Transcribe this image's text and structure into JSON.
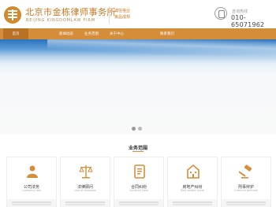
{
  "header": {
    "firm_name": "北京市金栋律师事务所",
    "firm_name_en": "BEIJING KINGDOMLAW FIRM",
    "slogan_line1": "诚信恪业",
    "slogan_line2": "良品成规",
    "hotline_label": "咨询热线",
    "hotline_number": "010-65071962"
  },
  "nav": {
    "items": [
      {
        "label": "首页",
        "active": true
      },
      {
        "label": "",
        "active": false
      },
      {
        "label": "新闻动态",
        "active": false
      },
      {
        "label": "业务范围",
        "active": false
      },
      {
        "label": "关于中心",
        "active": false
      },
      {
        "label": "",
        "active": false
      },
      {
        "label": "联系我们",
        "active": false
      }
    ]
  },
  "section": {
    "title": "业务范围"
  },
  "cards": [
    {
      "title": "公司法务",
      "subtitle": "Company law",
      "icon": "people-icon"
    },
    {
      "title": "法律顾问",
      "subtitle": "Law of business",
      "icon": "scales-icon"
    },
    {
      "title": "合同纠纷",
      "subtitle": "Contract case",
      "icon": "document-icon"
    },
    {
      "title": "房地产纠纷",
      "subtitle": "Real estate issue",
      "icon": "building-icon"
    },
    {
      "title": "刑事辩护",
      "subtitle": "Criminal defense",
      "icon": "gavel-icon"
    }
  ],
  "colors": {
    "accent": "#d48e3a",
    "nav_active": "#b97126",
    "brand_text": "#c8751f"
  }
}
